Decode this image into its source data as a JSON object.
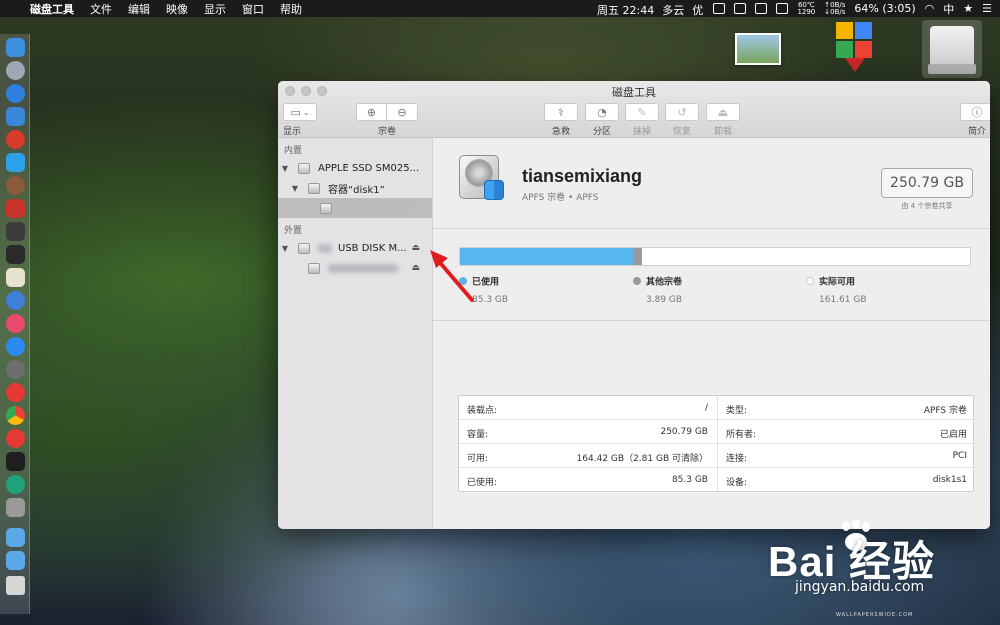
{
  "menubar": {
    "apple": "",
    "app_name": "磁盘工具",
    "menus": [
      "文件",
      "编辑",
      "映像",
      "显示",
      "窗口",
      "帮助"
    ],
    "temp": "60℃",
    "fan": "1290",
    "net_up": "0B/s",
    "net_down": "0B/s",
    "clock": "周五 22:44",
    "weather": "多云",
    "aqi": "优",
    "battery": "64% (3:05)",
    "input_method": "中"
  },
  "window": {
    "title": "磁盘工具",
    "toolbar": {
      "view": "显示",
      "volume": "宗卷",
      "first_aid": "急救",
      "partition": "分区",
      "erase": "抹掉",
      "restore": "恢复",
      "unmount": "卸载",
      "info": "简介"
    }
  },
  "sidebar": {
    "internal_header": "内置",
    "internal_disk": "APPLE SSD SM025...",
    "container": "容器“disk1”",
    "external_header": "外置",
    "usb_disk": "USB DISK M..."
  },
  "volume": {
    "name": "tiansemixiang",
    "subtitle": "APFS 宗卷 • APFS",
    "capacity": "250.79 GB",
    "capacity_note": "由 4 个宗卷共享"
  },
  "usage": {
    "used_fraction": 0.34,
    "other_fraction": 0.016,
    "used_label": "已使用",
    "used_value": "85.3 GB",
    "other_label": "其他宗卷",
    "other_value": "3.89 GB",
    "free_label": "实际可用",
    "free_value": "161.61 GB",
    "used_color": "#57b6ee",
    "other_color": "#9a9a9a"
  },
  "info": {
    "left": [
      {
        "k": "装载点:",
        "v": "/"
      },
      {
        "k": "容量:",
        "v": "250.79 GB"
      },
      {
        "k": "可用:",
        "v": "164.42 GB（2.81 GB 可清除）"
      },
      {
        "k": "已使用:",
        "v": "85.3 GB"
      }
    ],
    "right": [
      {
        "k": "类型:",
        "v": "APFS 宗卷"
      },
      {
        "k": "所有者:",
        "v": "已启用"
      },
      {
        "k": "连接:",
        "v": "PCI"
      },
      {
        "k": "设备:",
        "v": "disk1s1"
      }
    ]
  },
  "watermark": {
    "brand": "Bai 经验",
    "url": "jingyan.baidu.com",
    "site": "WALLPAPERSWIDE.COM"
  }
}
